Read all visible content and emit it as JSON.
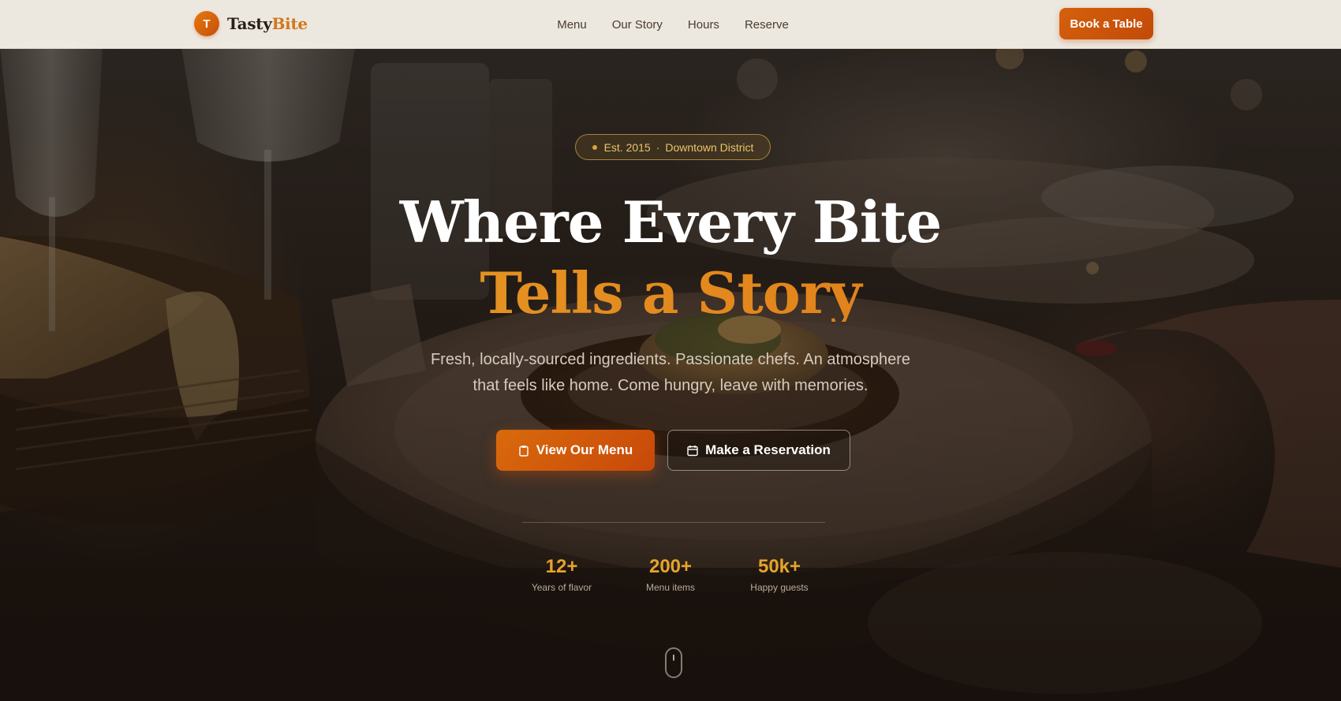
{
  "brand": {
    "initial": "T",
    "name_part1": "Tasty",
    "name_part2": "Bite"
  },
  "nav": {
    "links": [
      {
        "label": "Menu"
      },
      {
        "label": "Our Story"
      },
      {
        "label": "Hours"
      },
      {
        "label": "Reserve"
      }
    ],
    "cta_label": "Book a Table"
  },
  "hero": {
    "badge": {
      "established": "Est. 2015",
      "separator": "·",
      "location": "Downtown District"
    },
    "title_line1": "Where Every Bite",
    "title_line2": "Tells a Story",
    "subtitle": "Fresh, locally-sourced ingredients. Passionate chefs. An atmosphere that feels like home. Come hungry, leave with memories.",
    "primary_button": {
      "label": "View Our Menu",
      "icon": "clipboard-icon"
    },
    "secondary_button": {
      "label": "Make a Reservation",
      "icon": "calendar-icon"
    },
    "stats": [
      {
        "value": "12+",
        "label": "Years of flavor"
      },
      {
        "value": "200+",
        "label": "Menu items"
      },
      {
        "value": "50k+",
        "label": "Happy guests"
      }
    ],
    "scroll_indicator": "mouse-icon"
  },
  "colors": {
    "accent": "#d5600c",
    "gold": "#e6a32a",
    "nav_bg": "#f5f0e8",
    "text_dark": "#2a1f16"
  }
}
